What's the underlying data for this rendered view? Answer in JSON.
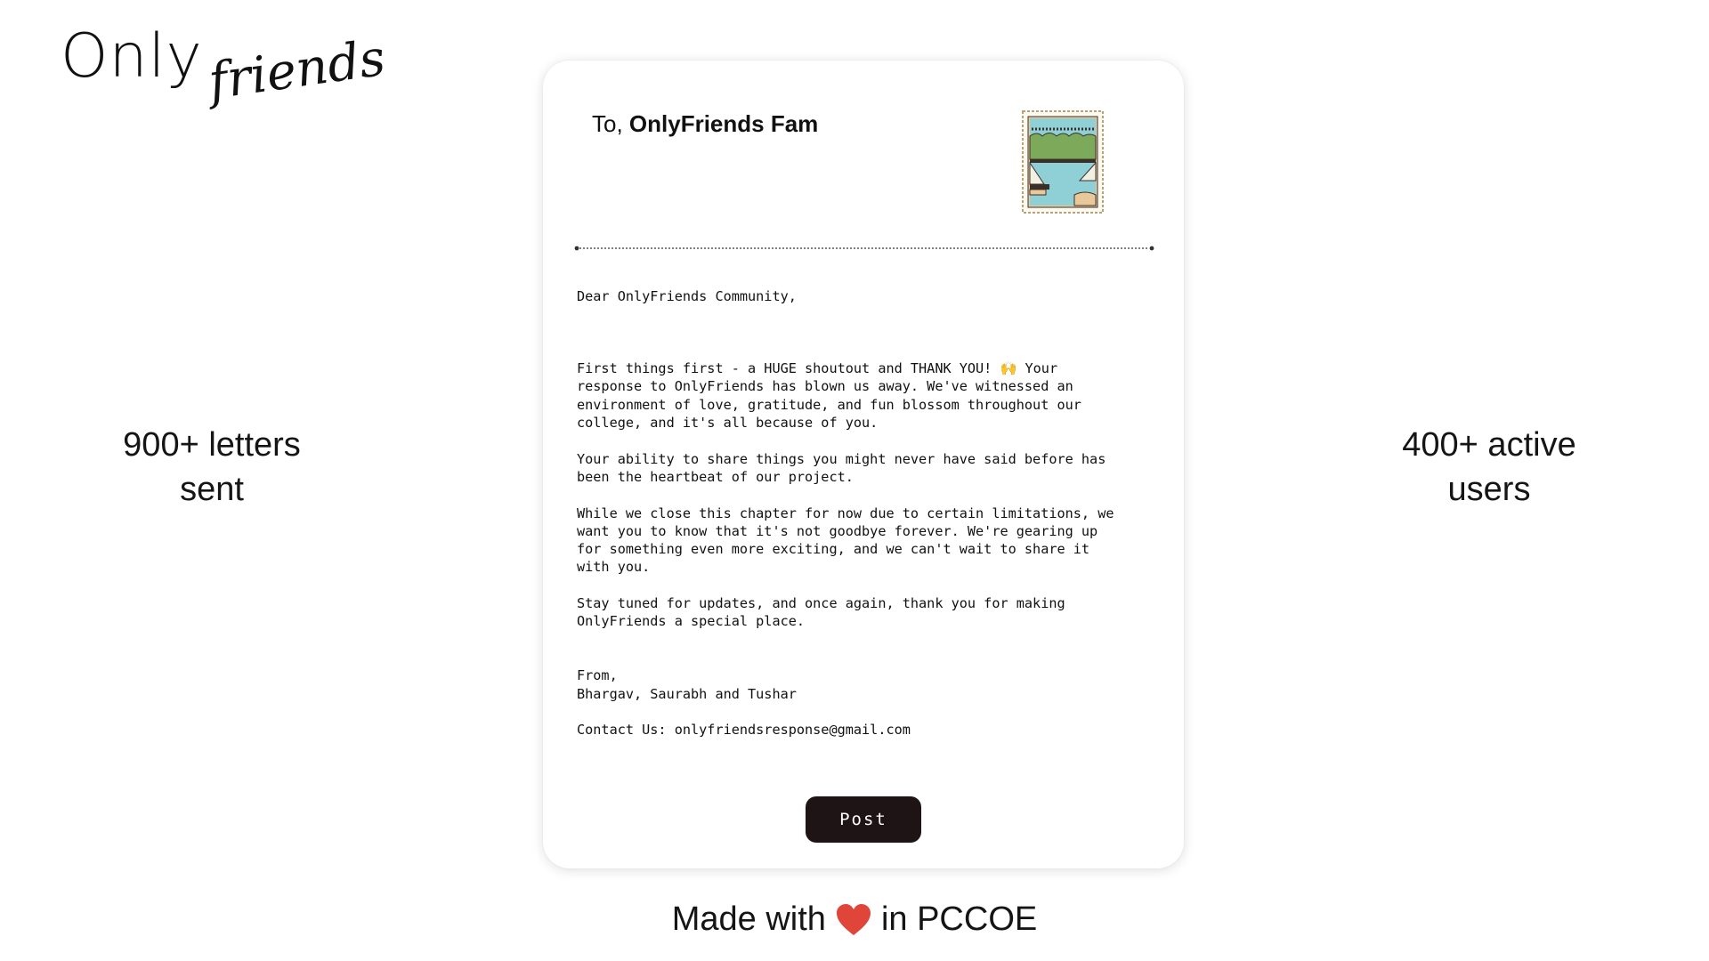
{
  "brand": {
    "logo_part1": "Only",
    "logo_part2": "friends"
  },
  "stats": {
    "letters_line1": "900+ letters",
    "letters_line2": "sent",
    "users_line1": "400+ active",
    "users_line2": "users"
  },
  "letter": {
    "to_prefix": "To,",
    "to_name": "OnlyFriends Fam",
    "stamp_icon": "postage-stamp-icon",
    "greeting": "Dear OnlyFriends Community,",
    "para1": "First things first - a HUGE shoutout and THANK YOU! 🙌 Your\nresponse to OnlyFriends has blown us away. We've witnessed an\nenvironment of love, gratitude, and fun blossom throughout our\ncollege, and it's all because of you.",
    "para2": "Your ability to share things you might never have said before has\nbeen the heartbeat of our project.",
    "para3": "While we close this chapter for now due to certain limitations, we\nwant you to know that it's not goodbye forever. We're gearing up\nfor something even more exciting, and we can't wait to share it\nwith you.",
    "para4": "Stay tuned for updates, and once again, thank you for making\nOnlyFriends a special place.",
    "signoff": "From,",
    "signers": "Bhargav, Saurabh and Tushar",
    "contact": "Contact Us: onlyfriendsresponse@gmail.com"
  },
  "actions": {
    "post_label": "Post"
  },
  "footer": {
    "prefix": "Made with",
    "icon": "heart-icon",
    "suffix": "in PCCOE"
  },
  "colors": {
    "button_bg": "#1e1416",
    "heart": "#e0453a",
    "text": "#111111"
  }
}
